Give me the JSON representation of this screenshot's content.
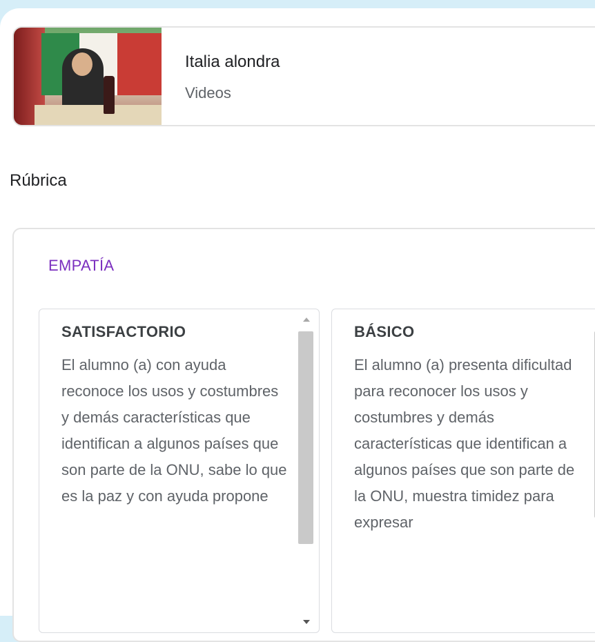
{
  "attachment": {
    "title": "Italia alondra",
    "subtitle": "Videos"
  },
  "rubric": {
    "heading": "Rúbrica",
    "criterion": "EMPATÍA",
    "levels": [
      {
        "title": "SATISFACTORIO",
        "description": "El alumno (a) con ayuda reconoce los usos y costumbres y demás características que identifican a algunos países que son parte de la ONU, sabe lo que es la paz y con ayuda propone"
      },
      {
        "title": "BÁSICO",
        "description": "El alumno (a) presenta dificultad para reconocer los usos y costumbres y demás características que identifican a algunos países que son parte de la ONU, muestra timidez para expresar"
      }
    ]
  },
  "colors": {
    "background": "#d6eef8",
    "criterion_accent": "#7b2fbf"
  }
}
